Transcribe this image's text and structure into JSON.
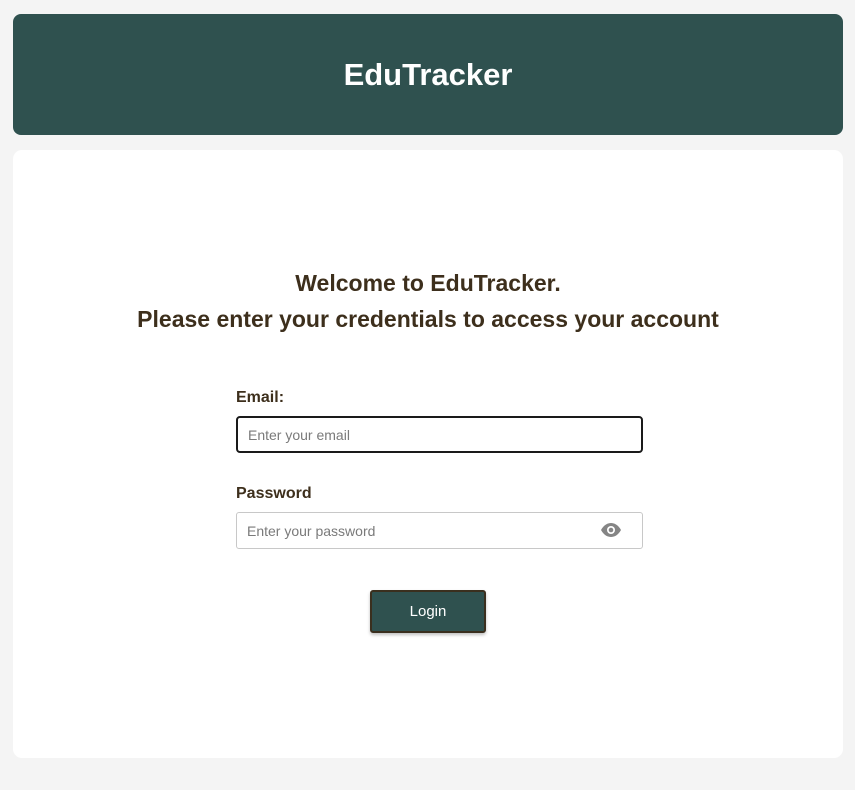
{
  "header": {
    "title": "EduTracker"
  },
  "welcome": {
    "line1": "Welcome to EduTracker.",
    "line2": "Please enter your credentials to access your account"
  },
  "form": {
    "email_label": "Email:",
    "email_value": "",
    "email_placeholder": "Enter your email",
    "password_label": "Password",
    "password_value": "",
    "password_placeholder": "Enter your password",
    "password_toggle_icon": "eye-icon",
    "login_label": "Login"
  },
  "colors": {
    "header_bg": "#2f514f",
    "text_brown": "#3d2f1c",
    "page_bg": "#f4f4f4"
  }
}
